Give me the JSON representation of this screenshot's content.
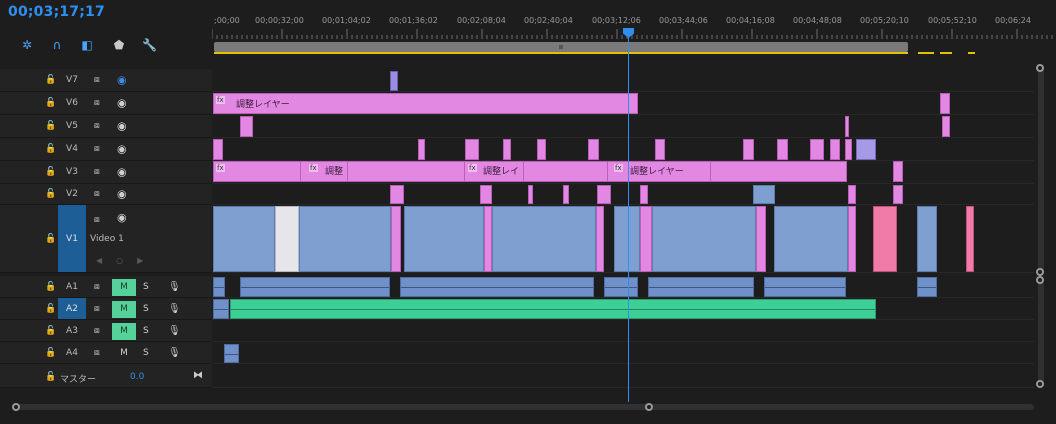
{
  "timecode": "00;03;17;17",
  "ruler": [
    "​;00;00",
    "00;00;32;00",
    "00;01;04;02",
    "00;01;36;02",
    "00;02;08;04",
    "00;02;40;04",
    "00;03;12;06",
    "00;03;44;06",
    "00;04;16;08",
    "00;04;48;08",
    "00;05;20;10",
    "00;05;52;10",
    "00;06;24"
  ],
  "tools": {
    "snap": "snap-icon",
    "linked": "linked-selection-icon",
    "marker": "add-marker-icon",
    "settings": "wrench-icon"
  },
  "video_tracks": [
    {
      "name": "V7",
      "eye": "off"
    },
    {
      "name": "V6",
      "eye": "on"
    },
    {
      "name": "V5",
      "eye": "on"
    },
    {
      "name": "V4",
      "eye": "on"
    },
    {
      "name": "V3",
      "eye": "on"
    },
    {
      "name": "V2",
      "eye": "on"
    },
    {
      "name": "V1",
      "eye": "on",
      "subtitle": "Video 1"
    }
  ],
  "audio_tracks": [
    {
      "name": "A1",
      "mute": "M",
      "mute_on": true,
      "solo": "S"
    },
    {
      "name": "A2",
      "mute": "M",
      "mute_on": true,
      "solo": "S"
    },
    {
      "name": "A3",
      "mute": "M",
      "mute_on": true,
      "solo": "S"
    },
    {
      "name": "A4",
      "mute": "M",
      "mute_on": false,
      "solo": "S"
    }
  ],
  "master": {
    "label": "マスター",
    "value": "0.0"
  },
  "clip_labels": {
    "v6_main": "調整レイヤー",
    "v3_a": "調整",
    "v3_b": "調整レイ",
    "v3_c": "調整レイヤー"
  },
  "colors": {
    "accent": "#2f8ff0",
    "adjustment": "#e288e2",
    "video": "#7e9fd0",
    "audio_green": "#3ecf96",
    "mute_on": "#55d29a"
  }
}
